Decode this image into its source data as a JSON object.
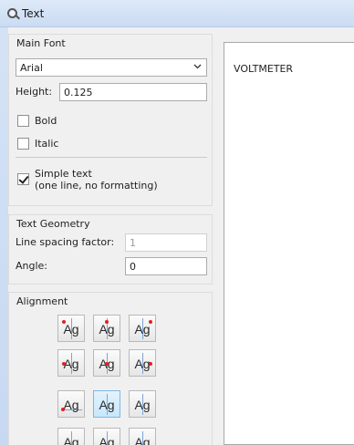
{
  "window": {
    "title": "Text"
  },
  "main_font": {
    "label": "Main Font",
    "font_value": "Arial",
    "height_label": "Height:",
    "height_value": "0.125",
    "bold_label": "Bold",
    "bold_checked": false,
    "italic_label": "Italic",
    "italic_checked": false,
    "simple_text_label_line1": "Simple text",
    "simple_text_label_line2": "(one line, no formatting)",
    "simple_text_checked": true
  },
  "text_geometry": {
    "label": "Text Geometry",
    "line_spacing_label": "Line spacing factor:",
    "line_spacing_value": "1",
    "angle_label": "Angle:",
    "angle_value": "0"
  },
  "alignment": {
    "label": "Alignment",
    "button_glyph": "Ag",
    "selected": "middle-center",
    "options": [
      "top-left",
      "top-center",
      "top-right",
      "middle-left",
      "middle-center",
      "middle-right",
      "baseline-left",
      "baseline-center",
      "baseline-right",
      "bottom-left",
      "bottom-center",
      "bottom-right"
    ]
  },
  "preview": {
    "text": "VOLTMETER"
  },
  "icons": {
    "app": "text-tool-icon",
    "dropdown": "chevron-down-icon"
  }
}
